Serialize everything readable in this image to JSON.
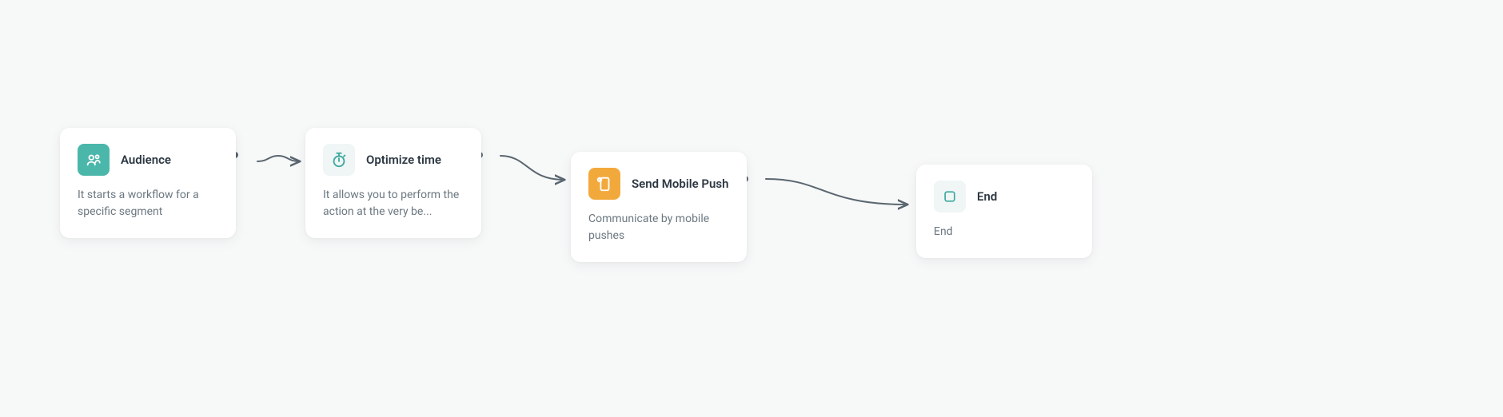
{
  "nodes": {
    "audience": {
      "title": "Audience",
      "description": "It starts a workflow for a specific segment",
      "icon_name": "audience-icon",
      "icon_color": "#4bb7ab"
    },
    "optimize": {
      "title": "Optimize time",
      "description": "It allows you to perform the action at the very be...",
      "icon_name": "stopwatch-icon",
      "icon_color": "#f0f5f5"
    },
    "push": {
      "title": "Send Mobile Push",
      "description": "Communicate by mobile pushes",
      "icon_name": "mobile-push-icon",
      "icon_color": "#f2a93c"
    },
    "end": {
      "title": "End",
      "description": "End",
      "icon_name": "end-icon",
      "icon_color": "#f0f5f5"
    }
  },
  "flow_order": [
    "audience",
    "optimize",
    "push",
    "end"
  ]
}
